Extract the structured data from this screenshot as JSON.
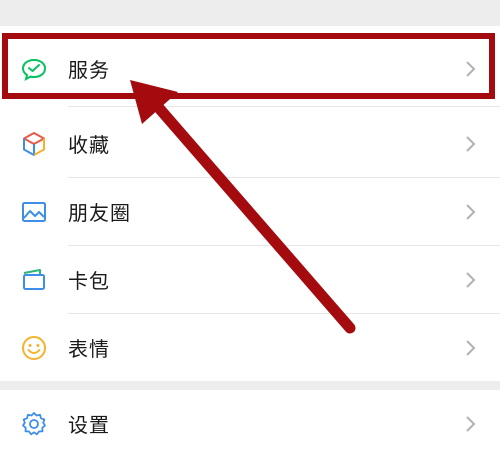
{
  "menu": {
    "items": [
      {
        "label": "服务",
        "icon": "wechat-pay-icon"
      },
      {
        "label": "收藏",
        "icon": "cube-icon"
      },
      {
        "label": "朋友圈",
        "icon": "image-icon"
      },
      {
        "label": "卡包",
        "icon": "wallet-icon"
      },
      {
        "label": "表情",
        "icon": "smile-icon"
      }
    ],
    "settings": {
      "label": "设置",
      "icon": "gear-icon"
    }
  },
  "annotation": {
    "highlight_color": "#a40b0e",
    "highlight_target": "服务"
  },
  "colors": {
    "background": "#ededed",
    "row_background": "#ffffff",
    "text": "#1a1a1a",
    "chevron": "#b2b2b2",
    "accent_green": "#07c160"
  }
}
